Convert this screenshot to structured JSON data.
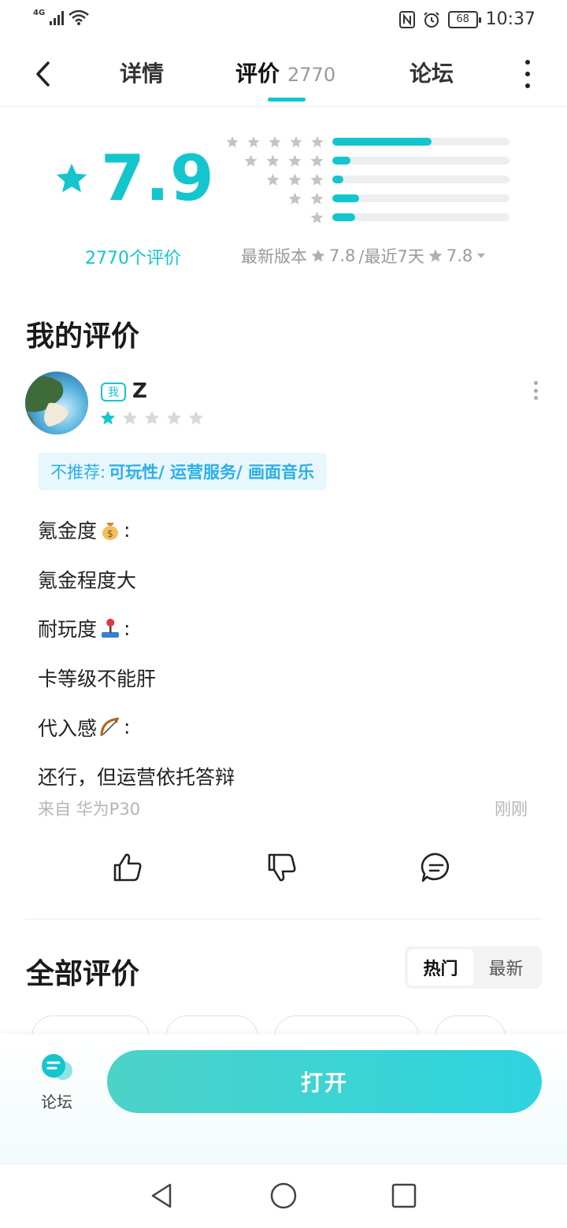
{
  "status_bar": {
    "network": "4G",
    "battery": "68",
    "time": "10:37"
  },
  "nav": {
    "tab_detail": "详情",
    "tab_review": "评价",
    "tab_review_count": "2770",
    "tab_forum": "论坛"
  },
  "summary": {
    "score": "7.9",
    "total_label": "2770个评价",
    "version_label": "最新版本",
    "version_score": "7.8",
    "recent_label": "/最近7天",
    "recent_score": "7.8",
    "distribution": [
      {
        "stars": 5,
        "fraction": 0.56
      },
      {
        "stars": 4,
        "fraction": 0.1
      },
      {
        "stars": 3,
        "fraction": 0.06
      },
      {
        "stars": 2,
        "fraction": 0.15
      },
      {
        "stars": 1,
        "fraction": 0.13
      }
    ]
  },
  "my_review": {
    "section_title": "我的评价",
    "me_badge": "我",
    "username": "Z",
    "rating": 1,
    "max_rating": 5,
    "not_recommend_label": "不推荐:",
    "not_recommend_items": "可玩性/ 运营服务/ 画面音乐",
    "line1": "氪金度",
    "line1_suffix": ":",
    "line2": "氪金程度大",
    "line3": "耐玩度",
    "line3_suffix": ":",
    "line4": "卡等级不能肝",
    "line5": "代入感",
    "line5_suffix": ":",
    "line6": "还行，但运营依托答辩",
    "from": "来自 华为P30",
    "time": "刚刚"
  },
  "all_reviews": {
    "section_title": "全部评价",
    "sort_hot": "热门",
    "sort_new": "最新"
  },
  "bottom": {
    "forum_label": "论坛",
    "open_label": "打开"
  },
  "colors": {
    "accent": "#15c5ce",
    "tag_blue": "#2ab0e6",
    "tag_bg": "#e8f6fd"
  }
}
